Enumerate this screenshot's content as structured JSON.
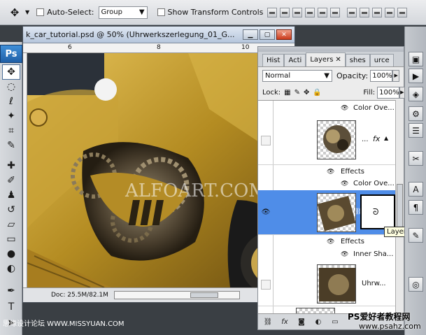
{
  "options_bar": {
    "tool_icon": "move-tool-icon",
    "auto_select_label": "Auto-Select:",
    "auto_select_value": "Group",
    "show_transform_label": "Show Transform Controls"
  },
  "tools": {
    "logo": "Ps",
    "items": [
      "move-tool-icon",
      "marquee-tool-icon",
      "lasso-tool-icon",
      "magic-wand-icon",
      "crop-tool-icon",
      "eyedropper-icon",
      "healing-brush-icon",
      "brush-icon",
      "clone-stamp-icon",
      "history-brush-icon",
      "eraser-icon",
      "gradient-icon",
      "blur-icon",
      "dodge-icon",
      "pen-icon",
      "type-tool-icon"
    ]
  },
  "document": {
    "title": "k_car_tutorial.psd @ 50% (Uhrwerkszerlegung_01_G...",
    "ruler_marks": [
      "6",
      "8",
      "10"
    ],
    "status": "Doc: 25.5M/82.1M",
    "watermark": "ALFOART.COM"
  },
  "layers_panel": {
    "tabs": [
      "Hist",
      "Acti",
      "Layers",
      "shes",
      "urce"
    ],
    "active_tab": "Layers",
    "blend_mode": "Normal",
    "opacity_label": "Opacity:",
    "opacity_value": "100%",
    "lock_label": "Lock:",
    "fill_label": "Fill:",
    "fill_value": "100%",
    "rows": {
      "top_effect": "Color Ove...",
      "layer1_dots": "...",
      "effects1": "Effects",
      "effect1_item": "Color Ove...",
      "effects2": "Effects",
      "effect2_item": "Inner Sha...",
      "layer3_name": "Uhrw..."
    },
    "tooltip": "Layer mask"
  },
  "watermarks": {
    "left": "思缘设计论坛 WWW.MISSYUAN.COM",
    "right_line1": "PS爱好者教程网",
    "right_line2": "www.psahz.com"
  }
}
